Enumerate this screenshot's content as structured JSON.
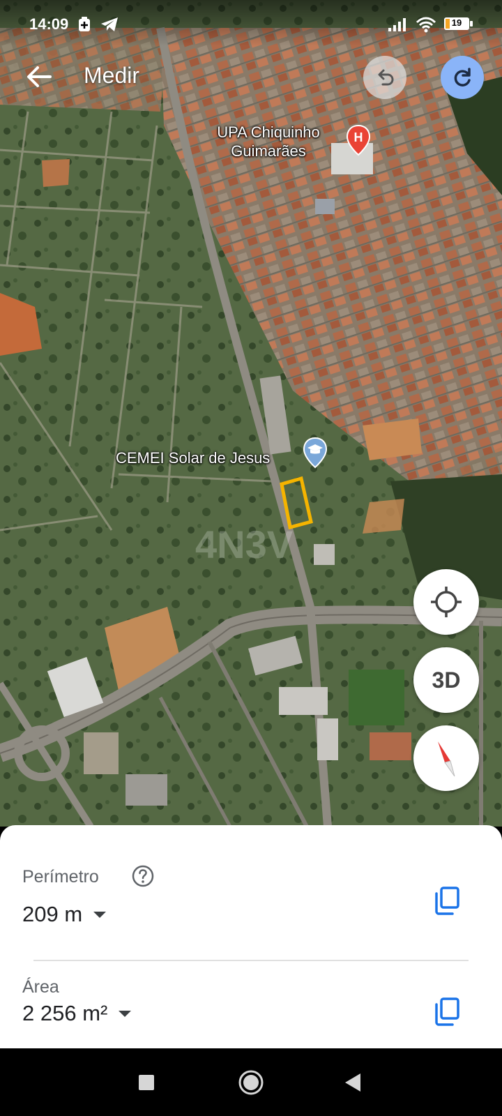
{
  "status_bar": {
    "time": "14:09",
    "battery_level": "19",
    "icons": [
      "notification-plus-icon",
      "telegram-icon",
      "signal-icon",
      "wifi-icon",
      "battery-icon"
    ]
  },
  "app_bar": {
    "title": "Medir",
    "back_icon": "arrow-back-icon",
    "undo_icon": "undo-icon",
    "redo_icon": "redo-icon"
  },
  "map": {
    "places": [
      {
        "name": "UPA Chiquinho Guimarães",
        "icon": "hospital-pin-icon",
        "color": "#ea4335"
      },
      {
        "name": "CEMEI Solar de Jesus",
        "icon": "school-pin-icon",
        "color": "#7aa7d9"
      }
    ],
    "measure_outline_color": "#f5b400",
    "controls": {
      "location_icon": "my-location-icon",
      "view_3d_label": "3D",
      "compass_icon": "compass-icon"
    }
  },
  "measurement": {
    "perimeter_label": "Perímetro",
    "perimeter_value": "209 m",
    "area_label": "Área",
    "area_value": "2 256 m²",
    "copy_icon": "copy-icon",
    "accent_color": "#1a73e8"
  },
  "nav_bar": {
    "icons": [
      "recent-apps-icon",
      "home-icon",
      "back-icon"
    ]
  }
}
